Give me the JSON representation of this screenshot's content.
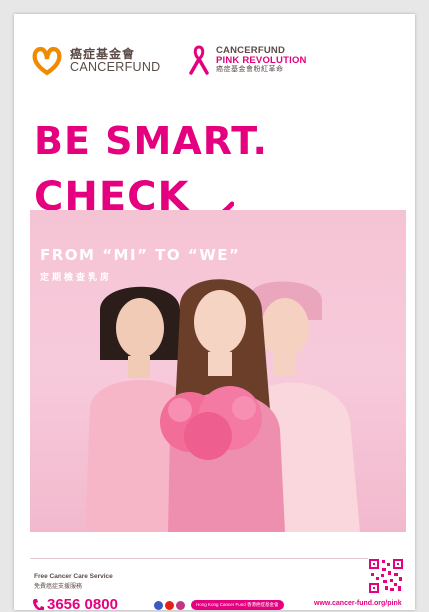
{
  "header": {
    "logo1_zh": "癌症基金會",
    "logo1_en": "CANCERFUND",
    "logo2_l1": "CANCERFUND",
    "logo2_l2": "PINK REVOLUTION",
    "logo2_l3": "癌症基金會粉紅革命"
  },
  "headline": {
    "line1": "BE SMART.",
    "line2": "CHECK"
  },
  "photo": {
    "subtitle_en": "FROM “MI” TO “WE”",
    "subtitle_zh": "定期檢查乳房"
  },
  "footer": {
    "service_en": "Free Cancer Care Service",
    "service_zh": "免費癌症支援服務",
    "phone": "3656 0800",
    "social_tag": "Hong Kong Cancer Fund 香港癌症基金會",
    "url": "www.cancer-fund.org/pink"
  },
  "colors": {
    "brand_pink": "#e4007f",
    "brand_orange": "#f08a00",
    "text_brown": "#5b4a46"
  }
}
